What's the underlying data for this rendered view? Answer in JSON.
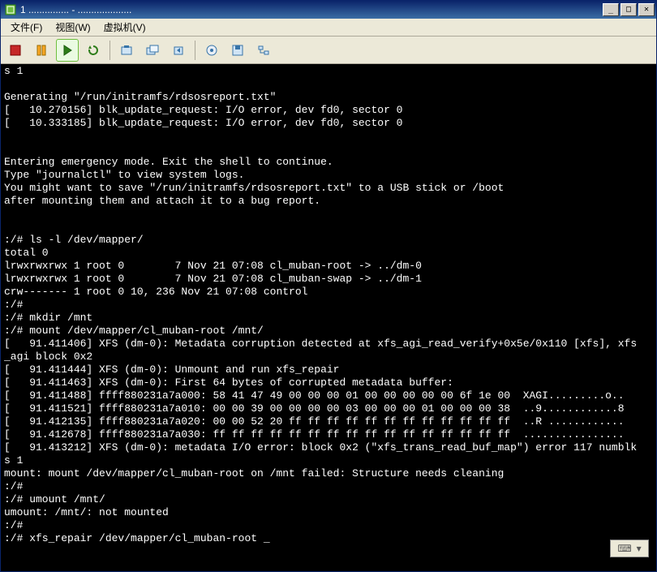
{
  "title": "1 ...............  - .................... ",
  "menu": {
    "file": "文件(F)",
    "view": "视图(W)",
    "vm": "虚拟机(V)"
  },
  "console_lines": [
    "s 1",
    "",
    "Generating \"/run/initramfs/rdsosreport.txt\"",
    "[   10.270156] blk_update_request: I/O error, dev fd0, sector 0",
    "[   10.333185] blk_update_request: I/O error, dev fd0, sector 0",
    "",
    "",
    "Entering emergency mode. Exit the shell to continue.",
    "Type \"journalctl\" to view system logs.",
    "You might want to save \"/run/initramfs/rdsosreport.txt\" to a USB stick or /boot",
    "after mounting them and attach it to a bug report.",
    "",
    "",
    ":/# ls -l /dev/mapper/",
    "total 0",
    "lrwxrwxrwx 1 root 0        7 Nov 21 07:08 cl_muban-root -> ../dm-0",
    "lrwxrwxrwx 1 root 0        7 Nov 21 07:08 cl_muban-swap -> ../dm-1",
    "crw------- 1 root 0 10, 236 Nov 21 07:08 control",
    ":/#",
    ":/# mkdir /mnt",
    ":/# mount /dev/mapper/cl_muban-root /mnt/",
    "[   91.411406] XFS (dm-0): Metadata corruption detected at xfs_agi_read_verify+0x5e/0x110 [xfs], xfs",
    "_agi block 0x2",
    "[   91.411444] XFS (dm-0): Unmount and run xfs_repair",
    "[   91.411463] XFS (dm-0): First 64 bytes of corrupted metadata buffer:",
    "[   91.411488] ffff880231a7a000: 58 41 47 49 00 00 00 01 00 00 00 00 00 6f 1e 00  XAGI.........o..",
    "[   91.411521] ffff880231a7a010: 00 00 39 00 00 00 00 03 00 00 00 01 00 00 00 38  ..9............8",
    "[   91.412135] ffff880231a7a020: 00 00 52 20 ff ff ff ff ff ff ff ff ff ff ff ff  ..R ............",
    "[   91.412678] ffff880231a7a030: ff ff ff ff ff ff ff ff ff ff ff ff ff ff ff ff  ................",
    "[   91.413212] XFS (dm-0): metadata I/O error: block 0x2 (\"xfs_trans_read_buf_map\") error 117 numblk",
    "s 1",
    "mount: mount /dev/mapper/cl_muban-root on /mnt failed: Structure needs cleaning",
    ":/#",
    ":/# umount /mnt/",
    "umount: /mnt/: not mounted",
    ":/#",
    ":/# xfs_repair /dev/mapper/cl_muban-root _"
  ],
  "titlebar_buttons": {
    "min": "_",
    "max": "□",
    "close": "✕"
  },
  "bottom_widget": {
    "icon": "⌨",
    "arrow": "▾"
  }
}
